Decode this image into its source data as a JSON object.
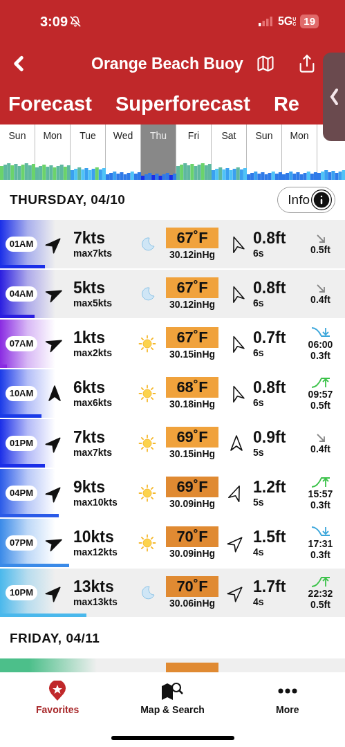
{
  "status_bar": {
    "time": "3:09",
    "network": "5G",
    "network_sub": "UC",
    "battery": "19"
  },
  "header": {
    "title": "Orange Beach Buoy"
  },
  "tabs": [
    {
      "label": "Forecast"
    },
    {
      "label": "Superforecast"
    },
    {
      "label": "Re"
    }
  ],
  "days": [
    {
      "label": "Sun",
      "selected": false
    },
    {
      "label": "Mon",
      "selected": false
    },
    {
      "label": "Tue",
      "selected": false
    },
    {
      "label": "Wed",
      "selected": false
    },
    {
      "label": "Thu",
      "selected": true
    },
    {
      "label": "Fri",
      "selected": false
    },
    {
      "label": "Sat",
      "selected": false
    },
    {
      "label": "Sun",
      "selected": false
    },
    {
      "label": "Mon",
      "selected": false
    }
  ],
  "sections": [
    {
      "title": "THURSDAY, 04/10",
      "info_button": "Info",
      "rows": [
        {
          "kind": "full",
          "time": "01AM",
          "color": "#1a2ee8",
          "level": 0.13,
          "wind_arrow": {
            "kind": "NE"
          },
          "wind": "7kts",
          "wind_max": "max7kts",
          "weather": {
            "kind": "moon"
          },
          "temp": {
            "text": "67˚F",
            "color": "#f0a23c"
          },
          "pressure": "30.12inHg",
          "swell_arrow": {
            "kind": "NNW"
          },
          "swell": "0.8ft",
          "period": "6s",
          "tide": {
            "kind": "none",
            "height": "0.5ft"
          }
        },
        {
          "kind": "full",
          "time": "04AM",
          "color": "#2a1ee0",
          "level": 0.1,
          "wind_arrow": {
            "kind": "ENE"
          },
          "wind": "5kts",
          "wind_max": "max5kts",
          "weather": {
            "kind": "moon"
          },
          "temp": {
            "text": "67˚F",
            "color": "#f0a23c"
          },
          "pressure": "30.12inHg",
          "swell_arrow": {
            "kind": "NNW"
          },
          "swell": "0.8ft",
          "period": "6s",
          "tide": {
            "kind": "none",
            "height": "0.4ft"
          }
        },
        {
          "kind": "full",
          "time": "07AM",
          "color": "#8a2be2",
          "level": 0.02,
          "wind_arrow": {
            "kind": "ENE"
          },
          "wind": "1kts",
          "wind_max": "max2kts",
          "weather": {
            "kind": "sun"
          },
          "temp": {
            "text": "67˚F",
            "color": "#f0a23c"
          },
          "pressure": "30.15inHg",
          "swell_arrow": {
            "kind": "NNW"
          },
          "swell": "0.7ft",
          "period": "6s",
          "tide": {
            "kind": "falling",
            "time": "06:00",
            "height": "0.3ft"
          }
        },
        {
          "kind": "full",
          "time": "10AM",
          "color": "#1a3ae8",
          "level": 0.12,
          "wind_arrow": {
            "kind": "N"
          },
          "wind": "6kts",
          "wind_max": "max6kts",
          "weather": {
            "kind": "sun"
          },
          "temp": {
            "text": "68˚F",
            "color": "#f0a23c"
          },
          "pressure": "30.18inHg",
          "swell_arrow": {
            "kind": "NNW"
          },
          "swell": "0.8ft",
          "period": "6s",
          "tide": {
            "kind": "rising",
            "time": "09:57",
            "height": "0.5ft"
          }
        },
        {
          "kind": "full",
          "time": "01PM",
          "color": "#1a2ee8",
          "level": 0.13,
          "wind_arrow": {
            "kind": "NE"
          },
          "wind": "7kts",
          "wind_max": "max7kts",
          "weather": {
            "kind": "sun"
          },
          "temp": {
            "text": "69˚F",
            "color": "#f0a23c"
          },
          "pressure": "30.15inHg",
          "swell_arrow": {
            "kind": "N"
          },
          "swell": "0.9ft",
          "period": "5s",
          "tide": {
            "kind": "none",
            "height": "0.4ft"
          }
        },
        {
          "kind": "full",
          "time": "04PM",
          "color": "#2a5ae8",
          "level": 0.17,
          "wind_arrow": {
            "kind": "NE"
          },
          "wind": "9kts",
          "wind_max": "max10kts",
          "weather": {
            "kind": "sun"
          },
          "temp": {
            "text": "69˚F",
            "color": "#e08a32"
          },
          "pressure": "30.09inHg",
          "swell_arrow": {
            "kind": "NNE"
          },
          "swell": "1.2ft",
          "period": "5s",
          "tide": {
            "kind": "rising",
            "time": "15:57",
            "height": "0.3ft"
          }
        },
        {
          "kind": "full",
          "time": "07PM",
          "color": "#3a8ae8",
          "level": 0.2,
          "wind_arrow": {
            "kind": "ENE"
          },
          "wind": "10kts",
          "wind_max": "max12kts",
          "weather": {
            "kind": "sun"
          },
          "temp": {
            "text": "70˚F",
            "color": "#e08a32"
          },
          "pressure": "30.09inHg",
          "swell_arrow": {
            "kind": "NE"
          },
          "swell": "1.5ft",
          "period": "4s",
          "tide": {
            "kind": "falling",
            "time": "17:31",
            "height": "0.3ft"
          }
        },
        {
          "kind": "full",
          "time": "10PM",
          "color": "#4ab8ec",
          "level": 0.25,
          "wind_arrow": {
            "kind": "NE"
          },
          "wind": "13kts",
          "wind_max": "max13kts",
          "weather": {
            "kind": "moon"
          },
          "temp": {
            "text": "70˚F",
            "color": "#e08a32"
          },
          "pressure": "30.06inHg",
          "swell_arrow": {
            "kind": "NE"
          },
          "swell": "1.7ft",
          "period": "4s",
          "tide": {
            "kind": "rising",
            "time": "22:32",
            "height": "0.5ft"
          }
        }
      ]
    },
    {
      "title": "FRIDAY, 04/11",
      "rows": [
        {
          "kind": "cut",
          "color": "#4cbf8a",
          "temp": {
            "color": "#e08a32"
          }
        }
      ]
    }
  ],
  "bottom_nav": [
    {
      "label": "Favorites",
      "selected": true
    },
    {
      "label": "Map & Search",
      "selected": false
    },
    {
      "label": "More",
      "selected": false
    }
  ]
}
